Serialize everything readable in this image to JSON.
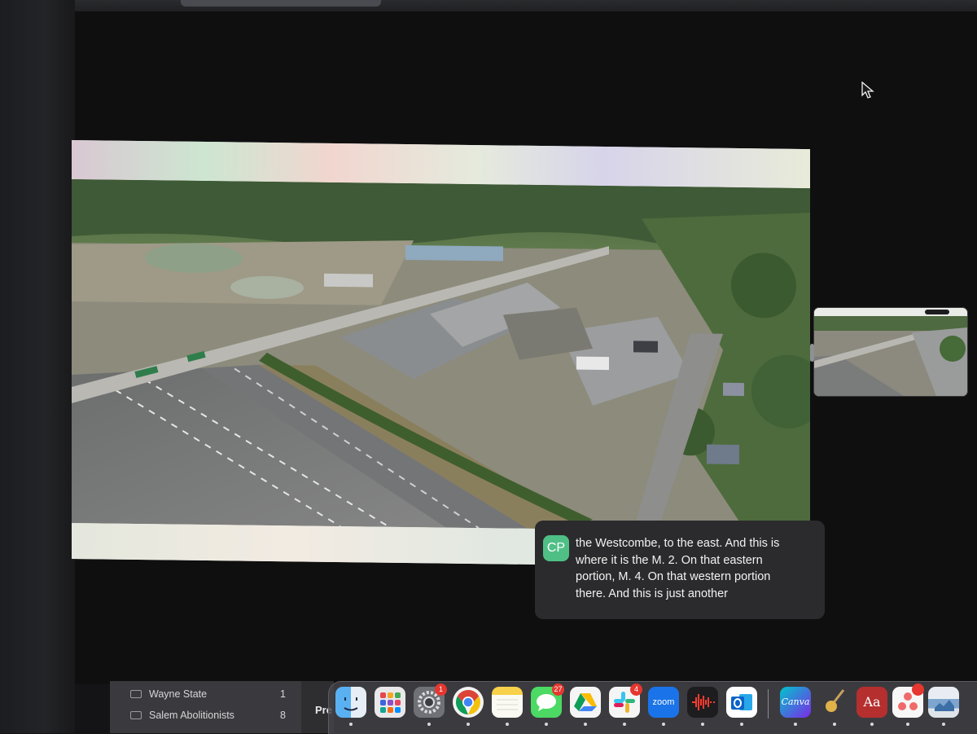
{
  "presentation": {
    "caption": {
      "avatar_initials": "CP",
      "lines": [
        "the Westcombe, to the east. And this is",
        "where it is the M. 2. On that eastern",
        "portion, M. 4. On that western portion",
        "there. And this is just another"
      ]
    }
  },
  "sidebar": {
    "folders": [
      {
        "label": "Wayne State",
        "count": "1"
      },
      {
        "label": "Salem Abolitionists",
        "count": "8"
      }
    ],
    "partial_label": "Pre"
  },
  "dock": {
    "apps": [
      {
        "name": "Finder",
        "icon": "finder-icon"
      },
      {
        "name": "Launchpad",
        "icon": "launchpad-icon"
      },
      {
        "name": "System Settings",
        "icon": "gear-icon",
        "badge": "1"
      },
      {
        "name": "Chrome",
        "icon": "chrome-icon"
      },
      {
        "name": "Notes",
        "icon": "notes-icon"
      },
      {
        "name": "Messages",
        "icon": "messages-icon",
        "badge": "27"
      },
      {
        "name": "Google Drive",
        "icon": "drive-icon"
      },
      {
        "name": "Slack",
        "icon": "slack-icon",
        "badge": "4"
      },
      {
        "name": "Zoom",
        "icon": "zoom-icon",
        "label": "zoom"
      },
      {
        "name": "Voice Memos",
        "icon": "voice-memos-icon"
      },
      {
        "name": "Outlook",
        "icon": "outlook-icon"
      },
      {
        "name": "Canva",
        "icon": "canva-icon",
        "label": "Canva"
      },
      {
        "name": "Comet",
        "icon": "comet-icon"
      },
      {
        "name": "Dictionary",
        "icon": "dictionary-icon",
        "label": "Aa"
      },
      {
        "name": "Asana",
        "icon": "asana-icon",
        "badge": ""
      },
      {
        "name": "Preview",
        "icon": "preview-icon"
      }
    ]
  },
  "colors": {
    "caption_bg": "#2b2b2d",
    "avatar": "#4fbf86",
    "badge": "#e5372f"
  }
}
